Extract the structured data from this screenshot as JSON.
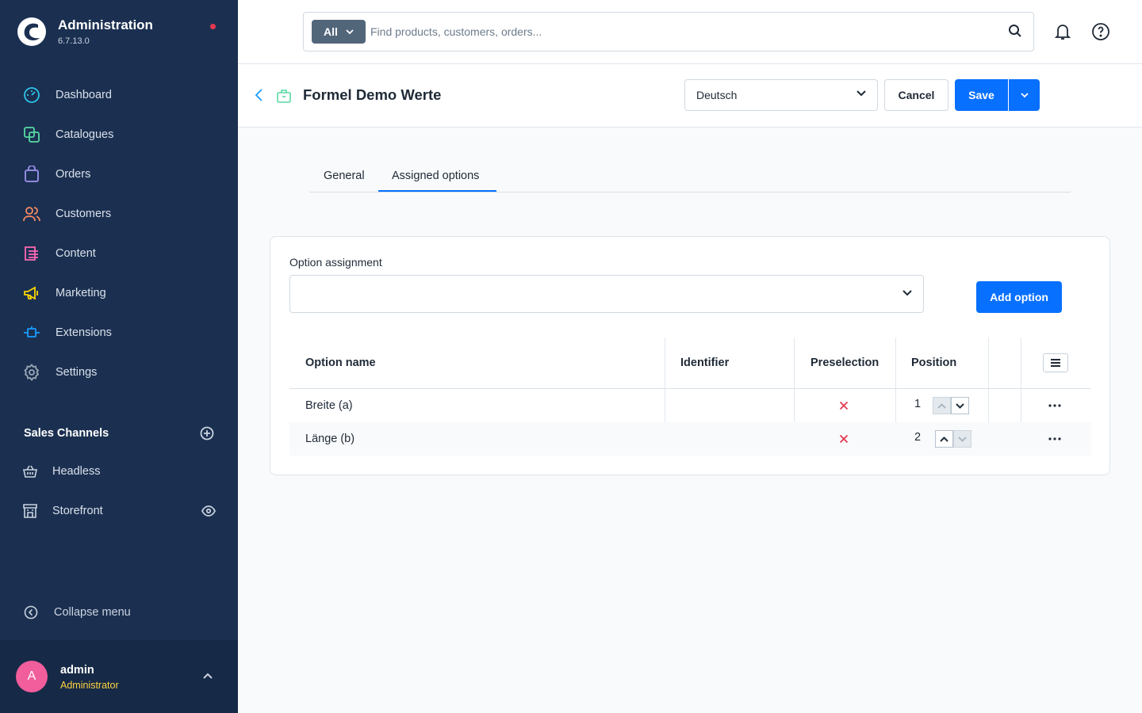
{
  "brand": {
    "title": "Administration",
    "version": "6.7.13.0"
  },
  "nav": [
    {
      "label": "Dashboard",
      "icon": "dashboard-icon",
      "color": "#2cc4e8"
    },
    {
      "label": "Catalogues",
      "icon": "catalogues-icon",
      "color": "#57d9a3"
    },
    {
      "label": "Orders",
      "icon": "orders-icon",
      "color": "#a092f0"
    },
    {
      "label": "Customers",
      "icon": "customers-icon",
      "color": "#f88962"
    },
    {
      "label": "Content",
      "icon": "content-icon",
      "color": "#ff68b4"
    },
    {
      "label": "Marketing",
      "icon": "marketing-icon",
      "color": "#ffd700"
    },
    {
      "label": "Extensions",
      "icon": "extensions-icon",
      "color": "#189eff"
    },
    {
      "label": "Settings",
      "icon": "settings-icon",
      "color": "#9aa8b5"
    }
  ],
  "sales_channels": {
    "title": "Sales Channels",
    "items": [
      {
        "label": "Headless",
        "icon": "basket-icon"
      },
      {
        "label": "Storefront",
        "icon": "storefront-icon"
      }
    ]
  },
  "collapse_label": "Collapse menu",
  "user": {
    "initial": "A",
    "name": "admin",
    "role": "Administrator"
  },
  "search": {
    "type_label": "All",
    "placeholder": "Find products, customers, orders..."
  },
  "smartbar": {
    "title": "Formel Demo Werte",
    "language": "Deutsch",
    "cancel_label": "Cancel",
    "save_label": "Save"
  },
  "tabs": [
    {
      "label": "General",
      "active": false
    },
    {
      "label": "Assigned options",
      "active": true
    }
  ],
  "option_assignment": {
    "label": "Option assignment",
    "value": "",
    "add_label": "Add option"
  },
  "grid": {
    "columns": [
      "Option name",
      "Identifier",
      "Preselection",
      "Position"
    ],
    "rows": [
      {
        "name": "Breite (a)",
        "identifier": "",
        "preselection": false,
        "position": "1"
      },
      {
        "name": "Länge (b)",
        "identifier": "",
        "preselection": false,
        "position": "2"
      }
    ]
  },
  "colors": {
    "sidebar": "#1b3051",
    "primary": "#0870ff",
    "danger": "#e53950",
    "role": "#ffd23f",
    "avatar": "#f25d9c"
  }
}
